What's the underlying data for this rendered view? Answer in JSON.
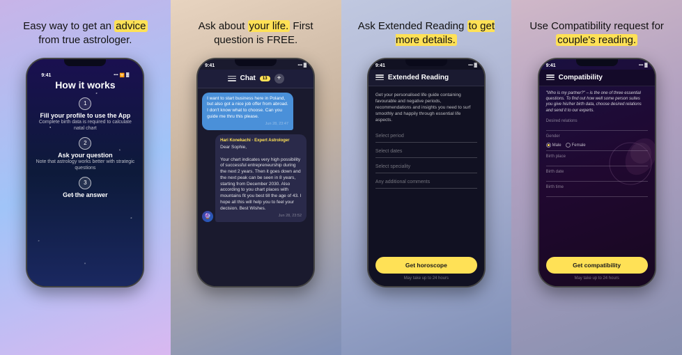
{
  "panels": [
    {
      "id": "panel-1",
      "caption_parts": [
        {
          "text": "Easy way to get an ",
          "highlight": false
        },
        {
          "text": "advice",
          "highlight": true
        },
        {
          "text": " from true astrologer.",
          "highlight": false
        }
      ],
      "caption_plain": "Easy way to get an advice from true astrologer.",
      "phone": {
        "time": "9:41",
        "screen": "how-it-works",
        "title": "How it works",
        "steps": [
          {
            "number": "1",
            "title": "Fill your profile to use the App",
            "desc": "Complete birth data is required to calculate natal chart"
          },
          {
            "number": "2",
            "title": "Ask your question",
            "desc": "Note that astrology works better with strategic questions"
          },
          {
            "number": "3",
            "title": "Get the answer",
            "desc": ""
          }
        ]
      }
    },
    {
      "id": "panel-2",
      "caption_parts": [
        {
          "text": "Ask about ",
          "highlight": false
        },
        {
          "text": "your life.",
          "highlight": true
        },
        {
          "text": " First question is FREE.",
          "highlight": false
        }
      ],
      "caption_plain": "Ask about your life. First question is FREE.",
      "phone": {
        "time": "9:41",
        "screen": "chat",
        "title": "Chat",
        "badge": "13",
        "user_msg": "I want to start business here in Poland, but also got a nice job offer from abroad. I don't know what to choose. Can you guide me thru this please.",
        "user_time": "Jun 28, 23:47",
        "astro_name": "Hari Konekachi",
        "astro_role": "Expert Astrologer",
        "astro_msg": "Dear Sophie,\n\nYour chart indicates very high possibility of successful entrepreneurship during the next 2 years. Then it goes down and the next peak can be seen in 8 years, starting from December 2030. Also according to you chart places with mountains fit you best till the age of 43. I hope all this will help you to feel your decision. Best Wishes.",
        "astro_time": "Jun 28, 23:52"
      }
    },
    {
      "id": "panel-3",
      "caption_parts": [
        {
          "text": "Ask Extended Reading ",
          "highlight": false
        },
        {
          "text": "to get more details.",
          "highlight": true
        }
      ],
      "caption_plain": "Ask Extended Reading to get more details.",
      "phone": {
        "time": "9:41",
        "screen": "extended-reading",
        "title": "Extended Reading",
        "desc": "Get your personalised life guide containing favourable and negative periods, recommendations and insights you need to surf smoothly and happily through essential life aspects.",
        "fields": [
          "Select period",
          "Select dates",
          "Select speciality",
          "Any additional comments"
        ],
        "button": "Get horoscope",
        "note": "May take up to 24 hours"
      }
    },
    {
      "id": "panel-4",
      "caption_parts": [
        {
          "text": "Use Compatibility request for ",
          "highlight": false
        },
        {
          "text": "couple's reading.",
          "highlight": true
        }
      ],
      "caption_plain": "Use Compatibility request for couple's reading.",
      "phone": {
        "time": "9:41",
        "screen": "compatibility",
        "title": "Compatibility",
        "quote": "\"Who is my partner?\" – is the one of three essential questions. To find out how well some person suites you give his/her birth data, choose desired relations and send it to our experts.",
        "fields": [
          {
            "label": "Desired relations",
            "value": ""
          },
          {
            "label": "Gender",
            "value": "",
            "type": "radio",
            "options": [
              "Male",
              "Female"
            ],
            "selected": "Male"
          },
          {
            "label": "Birth place",
            "value": ""
          },
          {
            "label": "Birth date",
            "value": ""
          },
          {
            "label": "Birth time",
            "value": ""
          }
        ],
        "button": "Get compatibility",
        "note": "May take up to 24 hours"
      }
    }
  ],
  "accent_color": "#FFE156",
  "button_label_horoscope": "Get horoscope",
  "button_label_compatibility": "Get compatibility",
  "note_text": "May take up to 24 hours"
}
